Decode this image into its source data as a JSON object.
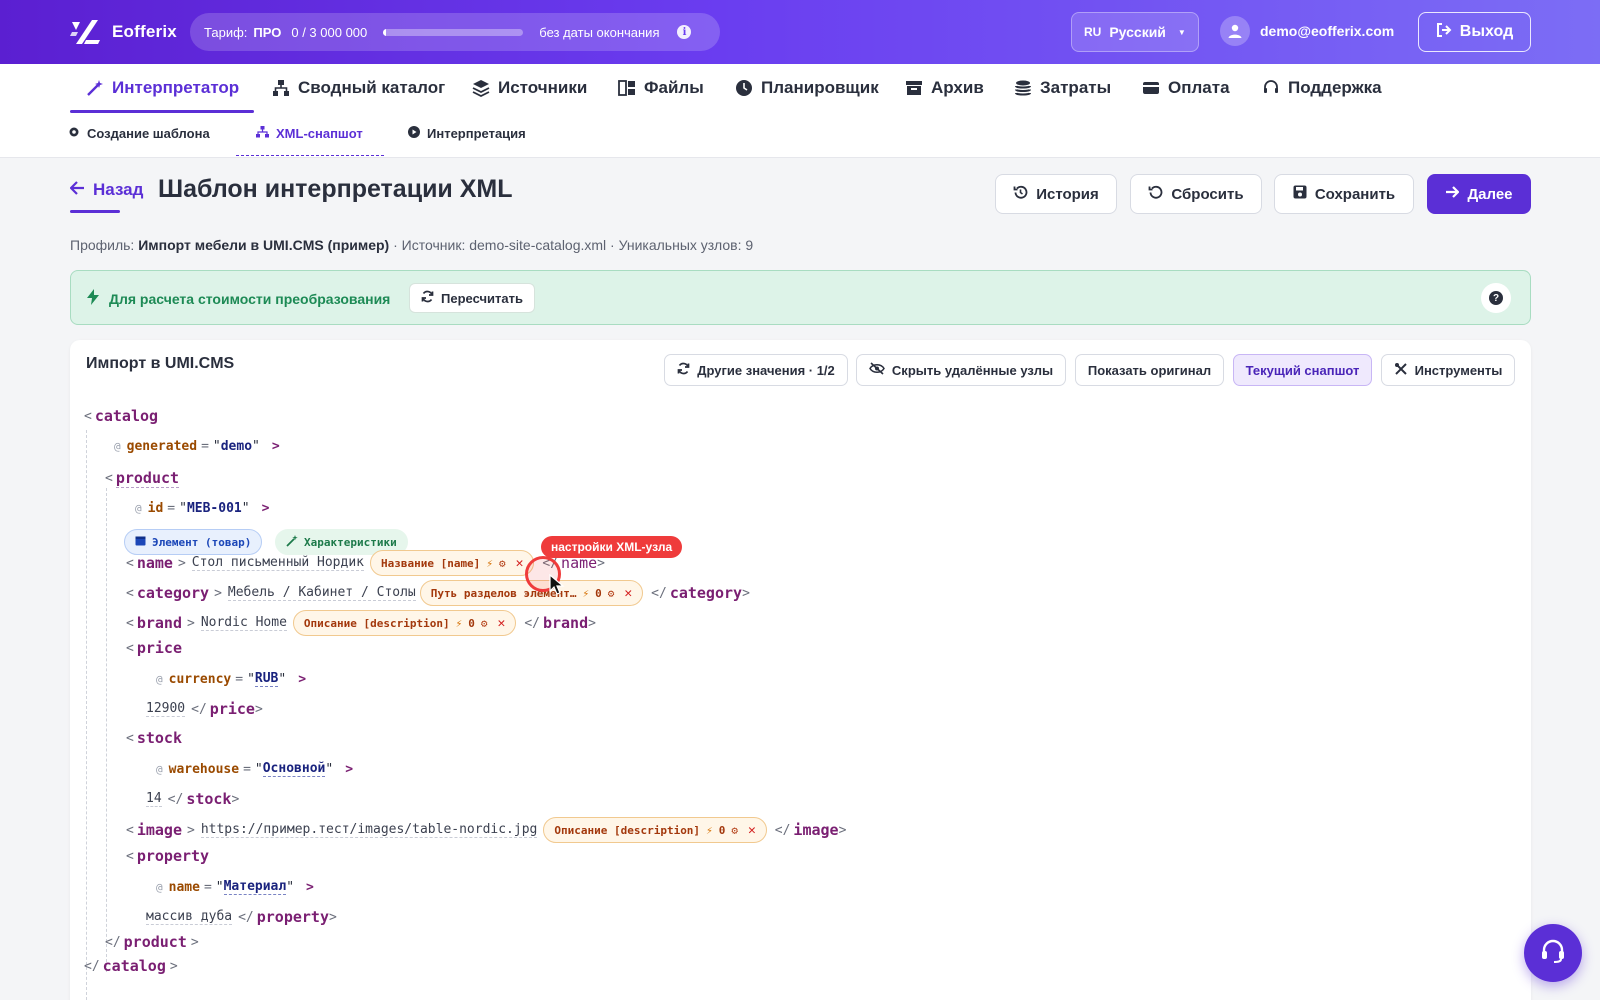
{
  "header": {
    "brand": "Eofferix",
    "tariff_label": "Тариф:",
    "tariff_plan": "ПРО",
    "tariff_usage": "0 / 3 000 000",
    "tariff_progress": 0.02,
    "tariff_expiry": "без даты окончания",
    "lang_code": "RU",
    "lang_name": "Русский",
    "user_email": "demo@eofferix.com",
    "logout": "Выход"
  },
  "nav": {
    "items": [
      {
        "label": "Интерпретатор",
        "icon": "magic-wand-icon"
      },
      {
        "label": "Сводный каталог",
        "icon": "hierarchy-icon"
      },
      {
        "label": "Источники",
        "icon": "layers-icon"
      },
      {
        "label": "Файлы",
        "icon": "files-icon"
      },
      {
        "label": "Планировщик",
        "icon": "clock-icon"
      },
      {
        "label": "Архив",
        "icon": "archive-icon"
      },
      {
        "label": "Затраты",
        "icon": "coins-icon"
      },
      {
        "label": "Оплата",
        "icon": "credit-card-icon"
      },
      {
        "label": "Поддержка",
        "icon": "headset-icon"
      }
    ],
    "sub": [
      {
        "label": "Создание шаблона"
      },
      {
        "label": "XML-снапшот"
      },
      {
        "label": "Интерпретация"
      }
    ]
  },
  "page": {
    "back": "Назад",
    "title": "Шаблон интерпретации XML",
    "history": "История",
    "reset": "Сбросить",
    "save": "Сохранить",
    "next": "Далее",
    "meta_profile_label": "Профиль:",
    "meta_profile": "Импорт мебели в UMI.CMS (пример)",
    "meta_rest": "· Источник: demo-site-catalog.xml · Уникальных узлов: 9"
  },
  "banner": {
    "text": "Для расчета стоимости преобразования",
    "recalc": "Пересчитать"
  },
  "card": {
    "title": "Импорт в UMI.CMS",
    "other_values": "Другие значения · 1/2",
    "hide_deleted": "Скрыть удалённые узлы",
    "show_original": "Показать оригинал",
    "current_snapshot": "Текущий снапшот",
    "tools": "Инструменты"
  },
  "xml": {
    "catalog": "catalog",
    "generated_attr": "generated",
    "generated_val": "demo",
    "product": "product",
    "id_attr": "id",
    "id_val": "MEB-001",
    "chip_element": "Элемент (товар)",
    "chip_props": "Характеристики",
    "name_tag": "name",
    "name_val": "Стол письменный Нордик",
    "name_map": "Название [name]",
    "category_tag": "category",
    "category_val": "Мебель / Кабинет / Столы",
    "category_map": "Путь разделов элемент…",
    "category_count": "0",
    "brand_tag": "brand",
    "brand_val": "Nordic Home",
    "brand_map": "Описание [description]",
    "brand_count": "0",
    "price_tag": "price",
    "currency_attr": "currency",
    "currency_val": "RUB",
    "price_val": "12900",
    "stock_tag": "stock",
    "warehouse_attr": "warehouse",
    "warehouse_val": "Основной",
    "stock_val": "14",
    "image_tag": "image",
    "image_val": "https://пример.тест/images/table-nordic.jpg",
    "image_map": "Описание [description]",
    "image_count": "0",
    "property_tag": "property",
    "pname_attr": "name",
    "pname_val": "Материал",
    "property_val": "массив дуба",
    "tooltip": "настройки XML-узла"
  },
  "colors": {
    "accent": "#5b2fd6",
    "tag": "#7a1f72",
    "attr": "#9a4a00",
    "danger": "#ef3b3b",
    "banner_bg": "#ddf3e8"
  }
}
